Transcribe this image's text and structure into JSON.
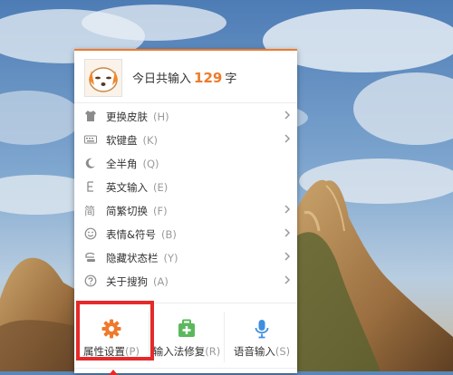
{
  "header": {
    "prefix": "今日共输入",
    "count": "129",
    "unit": "字"
  },
  "items": [
    {
      "label": "更换皮肤",
      "shortcut": "(H)",
      "icon": "tshirt-icon",
      "submenu": true
    },
    {
      "label": "软键盘",
      "shortcut": "(K)",
      "icon": "keyboard-icon",
      "submenu": true
    },
    {
      "label": "全半角",
      "shortcut": "(Q)",
      "icon": "moon-icon",
      "submenu": false
    },
    {
      "label": "英文输入",
      "shortcut": "(E)",
      "icon": "letter-e-icon",
      "submenu": false
    },
    {
      "label": "简繁切换",
      "shortcut": "(F)",
      "icon": "traditional-char-icon",
      "submenu": true
    },
    {
      "label": "表情&符号",
      "shortcut": "(B)",
      "icon": "smiley-icon",
      "submenu": true
    },
    {
      "label": "隐藏状态栏",
      "shortcut": "(Y)",
      "icon": "hide-statusbar-icon",
      "submenu": true
    },
    {
      "label": "关于搜狗",
      "shortcut": "(A)",
      "icon": "question-icon",
      "submenu": true
    }
  ],
  "bottom": [
    {
      "label": "属性设置",
      "shortcut": "(P)",
      "icon": "gear-icon"
    },
    {
      "label": "输入法修复",
      "shortcut": "(R)",
      "icon": "toolbox-repair-icon"
    },
    {
      "label": "语音输入",
      "shortcut": "(S)",
      "icon": "microphone-icon"
    }
  ],
  "colors": {
    "accent": "#ef7a2b",
    "highlight": "#e52a2a",
    "repair": "#5cb85c",
    "voice": "#3d8fe0"
  }
}
